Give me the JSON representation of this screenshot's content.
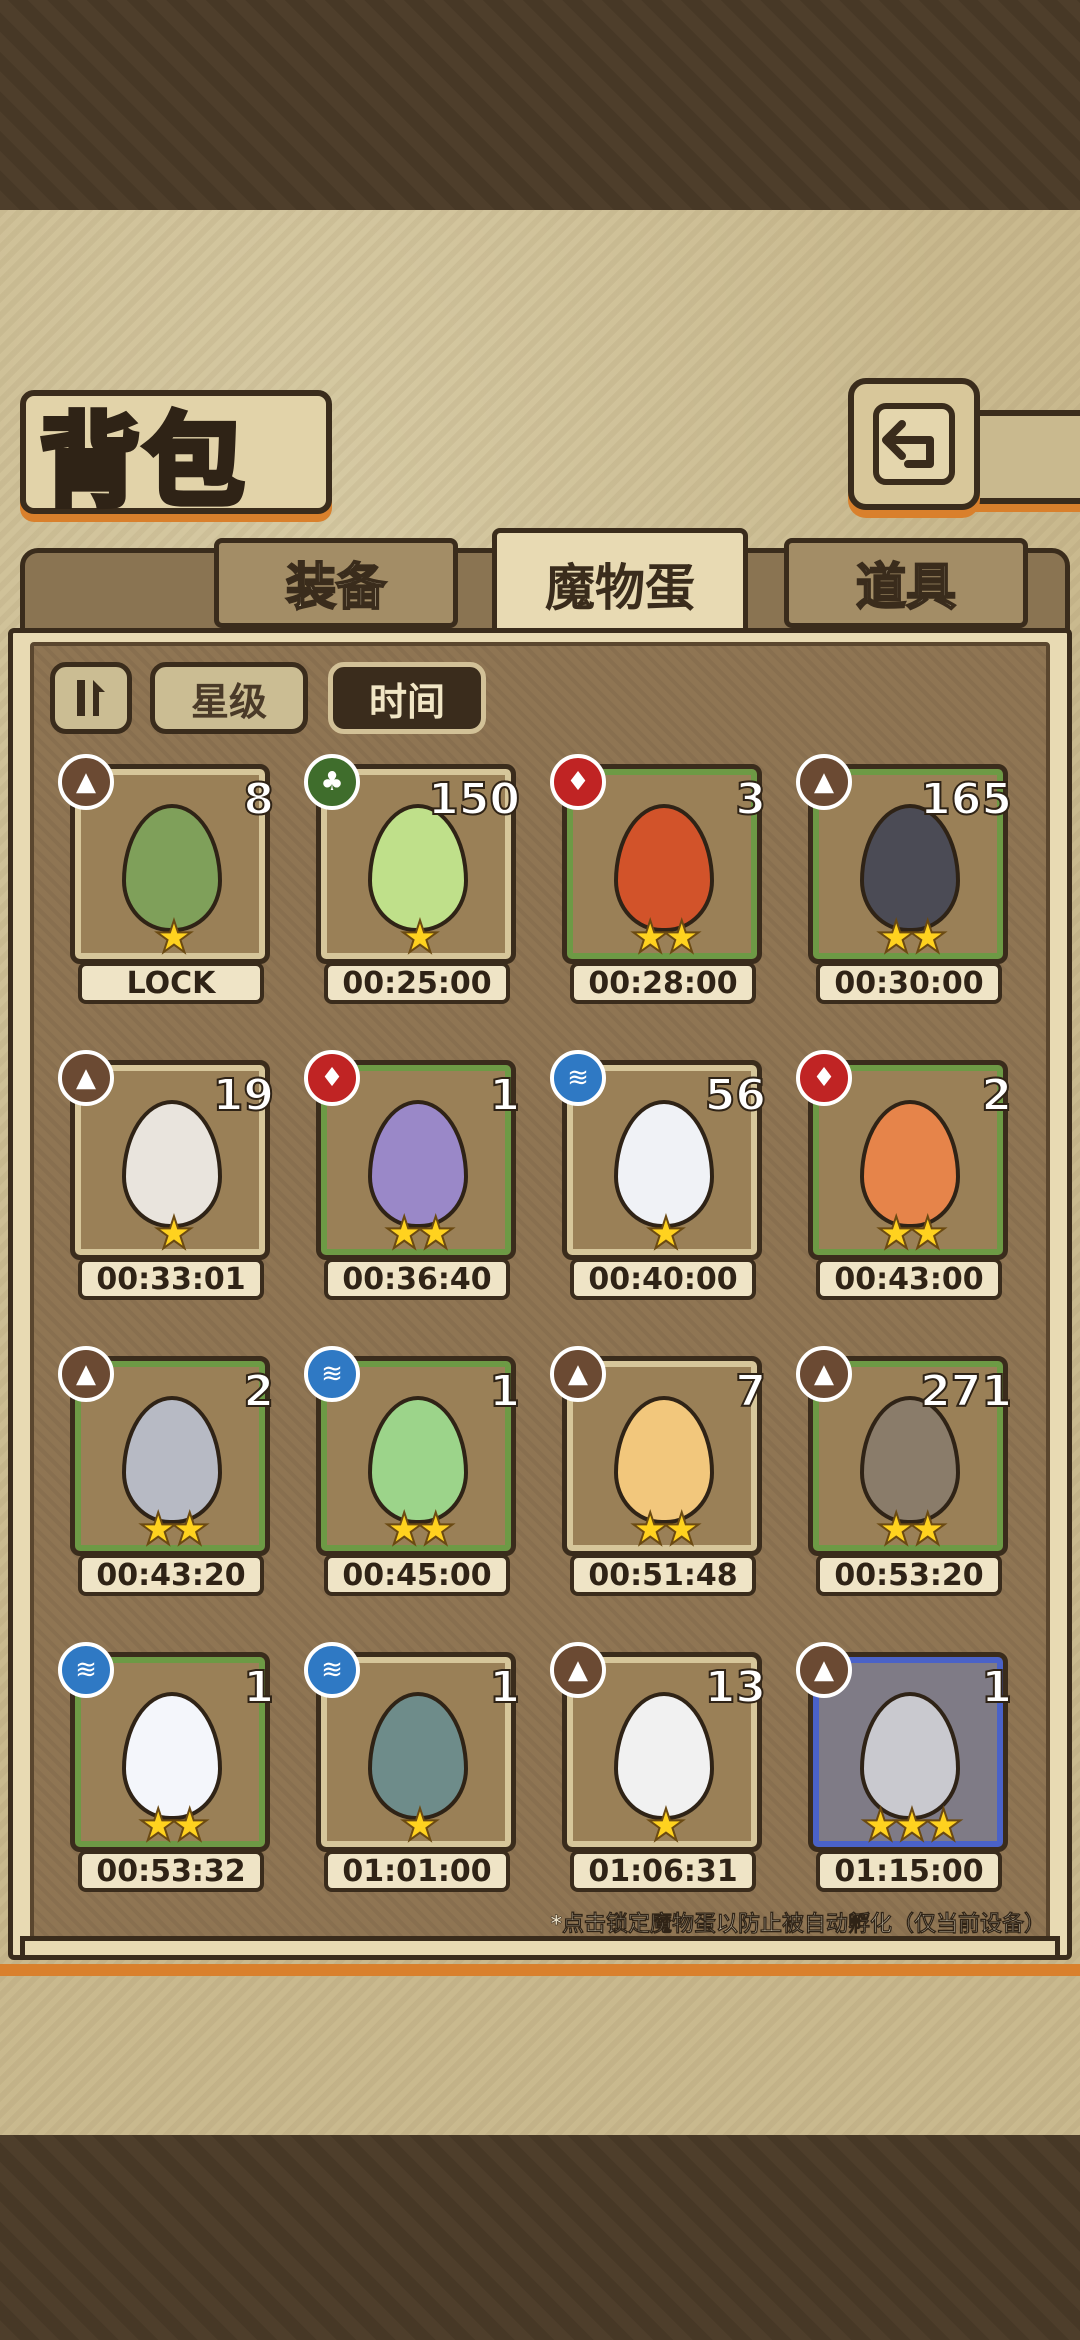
{
  "header": {
    "title": "背包"
  },
  "tabs": [
    {
      "label": "装备",
      "active": false
    },
    {
      "label": "魔物蛋",
      "active": true
    },
    {
      "label": "道具",
      "active": false
    }
  ],
  "filters": {
    "star_label": "星级",
    "time_label": "时间",
    "active": "时间"
  },
  "eggs": [
    {
      "count": "8",
      "timer": "LOCK",
      "element": "earth",
      "stars": "★",
      "color": "#7fa05a",
      "frame": "plain"
    },
    {
      "count": "150",
      "timer": "00:25:00",
      "element": "plant",
      "stars": "★",
      "color": "#bfe08a",
      "frame": "plain"
    },
    {
      "count": "3",
      "timer": "00:28:00",
      "element": "fire",
      "stars": "★★",
      "color": "#d2532a",
      "frame": "green"
    },
    {
      "count": "165",
      "timer": "00:30:00",
      "element": "earth",
      "stars": "★★",
      "color": "#4b4b55",
      "frame": "green"
    },
    {
      "count": "19",
      "timer": "00:33:01",
      "element": "earth",
      "stars": "★",
      "color": "#e9e4dd",
      "frame": "plain"
    },
    {
      "count": "1",
      "timer": "00:36:40",
      "element": "fire",
      "stars": "★★",
      "color": "#9a88c8",
      "frame": "green"
    },
    {
      "count": "56",
      "timer": "00:40:00",
      "element": "water",
      "stars": "★",
      "color": "#f0f2f6",
      "frame": "plain"
    },
    {
      "count": "2",
      "timer": "00:43:00",
      "element": "fire",
      "stars": "★★",
      "color": "#e6844a",
      "frame": "green"
    },
    {
      "count": "2",
      "timer": "00:43:20",
      "element": "earth",
      "stars": "★★",
      "color": "#b7bac4",
      "frame": "green"
    },
    {
      "count": "1",
      "timer": "00:45:00",
      "element": "water",
      "stars": "★★",
      "color": "#9cd48a",
      "frame": "green"
    },
    {
      "count": "7",
      "timer": "00:51:48",
      "element": "earth",
      "stars": "★★",
      "color": "#f2c77c",
      "frame": "plain"
    },
    {
      "count": "271",
      "timer": "00:53:20",
      "element": "earth",
      "stars": "★★",
      "color": "#8a7c6a",
      "frame": "green"
    },
    {
      "count": "1",
      "timer": "00:53:32",
      "element": "water",
      "stars": "★★",
      "color": "#f4f6fb",
      "frame": "green"
    },
    {
      "count": "1",
      "timer": "01:01:00",
      "element": "water",
      "stars": "★",
      "color": "#6e8c8a",
      "frame": "plain"
    },
    {
      "count": "13",
      "timer": "01:06:31",
      "element": "earth",
      "stars": "★",
      "color": "#f1f1f1",
      "frame": "plain"
    },
    {
      "count": "1",
      "timer": "01:15:00",
      "element": "earth",
      "stars": "★★★",
      "color": "#c9c9cf",
      "frame": "blue"
    }
  ],
  "footnote": "*点击锁定魔物蛋以防止被自动孵化（仅当前设备）",
  "icons": {
    "back": "back-arrow-icon",
    "sort": "sort-order-icon"
  }
}
